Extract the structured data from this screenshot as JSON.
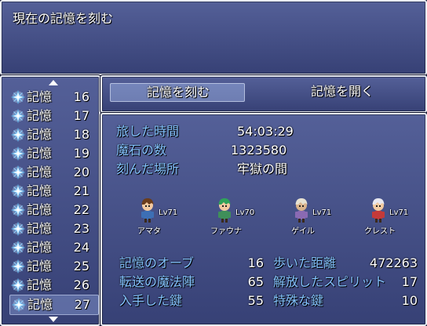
{
  "help": {
    "text": "現在の記憶を刻む"
  },
  "slots": [
    {
      "label": "記憶",
      "number": "16",
      "selected": false
    },
    {
      "label": "記憶",
      "number": "17",
      "selected": false
    },
    {
      "label": "記憶",
      "number": "18",
      "selected": false
    },
    {
      "label": "記憶",
      "number": "19",
      "selected": false
    },
    {
      "label": "記憶",
      "number": "20",
      "selected": false
    },
    {
      "label": "記憶",
      "number": "21",
      "selected": false
    },
    {
      "label": "記憶",
      "number": "22",
      "selected": false
    },
    {
      "label": "記憶",
      "number": "23",
      "selected": false
    },
    {
      "label": "記憶",
      "number": "24",
      "selected": false
    },
    {
      "label": "記憶",
      "number": "25",
      "selected": false
    },
    {
      "label": "記憶",
      "number": "26",
      "selected": false
    },
    {
      "label": "記憶",
      "number": "27",
      "selected": true
    }
  ],
  "commands": {
    "save": "記憶を刻む",
    "load": "記憶を開く",
    "selected": "save"
  },
  "info": {
    "playtime_label": "旅した時間",
    "playtime_value": "54:03:29",
    "gems_label": "魔石の数",
    "gems_value": "1323580",
    "location_label": "刻んだ場所",
    "location_value": "牢獄の間"
  },
  "party": [
    {
      "name": "アマタ",
      "level": "Lv71",
      "colors": {
        "hair": "#6b3d1c",
        "body": "#3d6fb5",
        "skin": "#f2c9a0"
      }
    },
    {
      "name": "ファウナ",
      "level": "Lv70",
      "colors": {
        "hair": "#2fa35a",
        "body": "#3f8f5a",
        "skin": "#f2c9a0"
      }
    },
    {
      "name": "ゲイル",
      "level": "Lv71",
      "colors": {
        "hair": "#e7e2d2",
        "body": "#8a6ab3",
        "skin": "#d9b38c"
      }
    },
    {
      "name": "クレスト",
      "level": "Lv71",
      "colors": {
        "hair": "#e8e8f0",
        "body": "#c43a3a",
        "skin": "#f2c9a0"
      }
    }
  ],
  "stats_left": [
    {
      "label": "記憶のオーブ",
      "value": "16"
    },
    {
      "label": "転送の魔法陣",
      "value": "65"
    },
    {
      "label": "入手した鍵",
      "value": "55"
    }
  ],
  "stats_right": [
    {
      "label": "歩いた距離",
      "value": "472263"
    },
    {
      "label": "解放したスピリット",
      "value": "17"
    },
    {
      "label": "特殊な鍵",
      "value": "10"
    }
  ],
  "colors": {
    "system_label": "#84c3ff",
    "text": "#ffffff"
  }
}
